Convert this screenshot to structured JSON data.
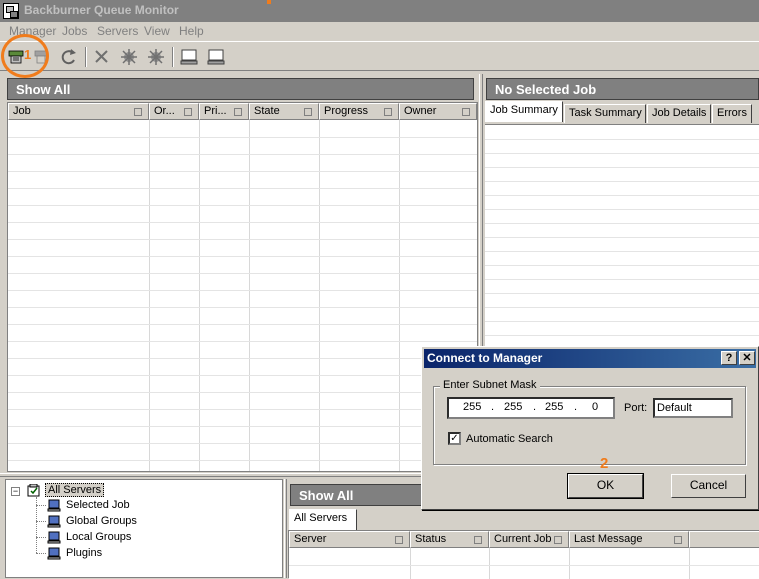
{
  "window": {
    "title": "Backburner Queue Monitor"
  },
  "menu": [
    "Manager",
    "Jobs",
    "Servers",
    "View",
    "Help"
  ],
  "toolbar": {
    "icons": [
      "connect-icon",
      "disconnect-icon",
      "refresh-icon",
      "delete-icon",
      "activate-icon",
      "deactivate-icon",
      "server-icon",
      "server2-icon"
    ]
  },
  "annotations": {
    "one": "1",
    "two": "2"
  },
  "jobs_panel": {
    "title": "Show All",
    "columns": [
      "Job",
      "Or...",
      "Pri...",
      "State",
      "Progress",
      "Owner"
    ]
  },
  "job_detail_panel": {
    "title": "No Selected Job",
    "tabs": [
      "Job Summary",
      "Task Summary",
      "Job Details",
      "Errors"
    ]
  },
  "tree": {
    "root": "All Servers",
    "children": [
      "Selected Job",
      "Global Groups",
      "Local Groups",
      "Plugins"
    ]
  },
  "servers_panel": {
    "title": "Show All",
    "tab": "All Servers",
    "columns": [
      "Server",
      "Status",
      "Current Job",
      "Last Message"
    ]
  },
  "dialog": {
    "title": "Connect to Manager",
    "help_label": "?",
    "close_label": "✕",
    "group_label": "Enter Subnet Mask",
    "ip": [
      "255",
      "255",
      "255",
      "0"
    ],
    "port_label": "Port:",
    "port_value": "Default",
    "auto_search_label": "Automatic Search",
    "auto_search_checked": true,
    "ok_label": "OK",
    "cancel_label": "Cancel"
  },
  "colors": {
    "annotation": "#f07c1c",
    "title_active": "#0a246a",
    "panel_header": "#808080"
  }
}
